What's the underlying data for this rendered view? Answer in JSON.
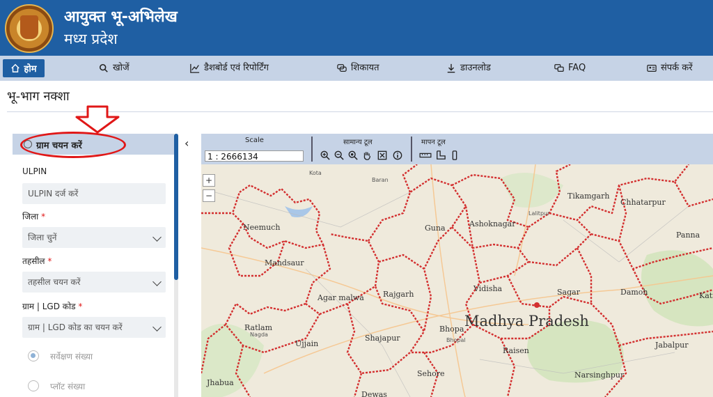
{
  "header": {
    "title_line1": "आयुक्त भू-अभिलेख",
    "title_line2": "मध्य प्रदेश"
  },
  "nav": {
    "home": "होम",
    "search": "खोजें",
    "dashboard": "डैशबोर्ड एवं रिपोर्टिंग",
    "complaint": "शिकायत",
    "download": "डाउनलोड",
    "faq": "FAQ",
    "contact": "संपर्क करें"
  },
  "page": {
    "title": "भू-भाग नक्शा"
  },
  "panel": {
    "heading": "ग्राम चयन करें",
    "ulpin_label": "ULPIN",
    "ulpin_placeholder": "ULPIN दर्ज करें",
    "district_label": "जिला",
    "district_value": "जिला चुनें",
    "tehsil_label": "तहसील",
    "tehsil_value": "तहसील चयन करें",
    "village_label": "ग्राम | LGD कोड",
    "village_value": "ग्राम | LGD कोड का चयन करें",
    "required_mark": "*",
    "radio_survey": "सर्वेक्षण संख्या",
    "radio_plot": "प्लॉट संख्या",
    "collapse_glyph": "‹"
  },
  "toolbar": {
    "scale_label": "Scale",
    "scale_value": "1 : 2666134",
    "general_tools_label": "सामान्य टूल",
    "measure_tools_label": "मापन टूल"
  },
  "map": {
    "zoom_in": "+",
    "zoom_out": "−",
    "state_label": "Madhya Pradesh",
    "cities": {
      "neemuch": "Neemuch",
      "mandsaur": "Mandsaur",
      "guna": "Guna",
      "ashoknagar": "Ashoknagar",
      "tikamgarh": "Tikamgarh",
      "chhatarpur": "Chhatarpur",
      "panna": "Panna",
      "agar_malwa": "Agar malwa",
      "rajgarh": "Rajgarh",
      "vidisha": "Vidisha",
      "sagar": "Sagar",
      "damoh": "Damoh",
      "katni": "Katn",
      "ratlam": "Ratlam",
      "ujjain": "Ujjain",
      "shajapur": "Shajapur",
      "bhopal": "Bhopa",
      "raisen": "Raisen",
      "jabalpur": "Jabalpur",
      "jhabua": "Jhabua",
      "sehore": "Sehore",
      "narsinghpur": "Narsinghpur",
      "dewas": "Dewas"
    },
    "small_labels": {
      "kota": "Kota",
      "baran": "Baran",
      "lalitpur": "Lalitpur",
      "bhopal_small": "Bhopal",
      "ratlam_small": "Nagda",
      "vidisha_small": "Vidisha"
    }
  },
  "colors": {
    "header_blue": "#1f5fa3",
    "nav_bg": "#c6d3e6",
    "boundary_red": "#d32f2f",
    "annotation_red": "#e01717"
  }
}
